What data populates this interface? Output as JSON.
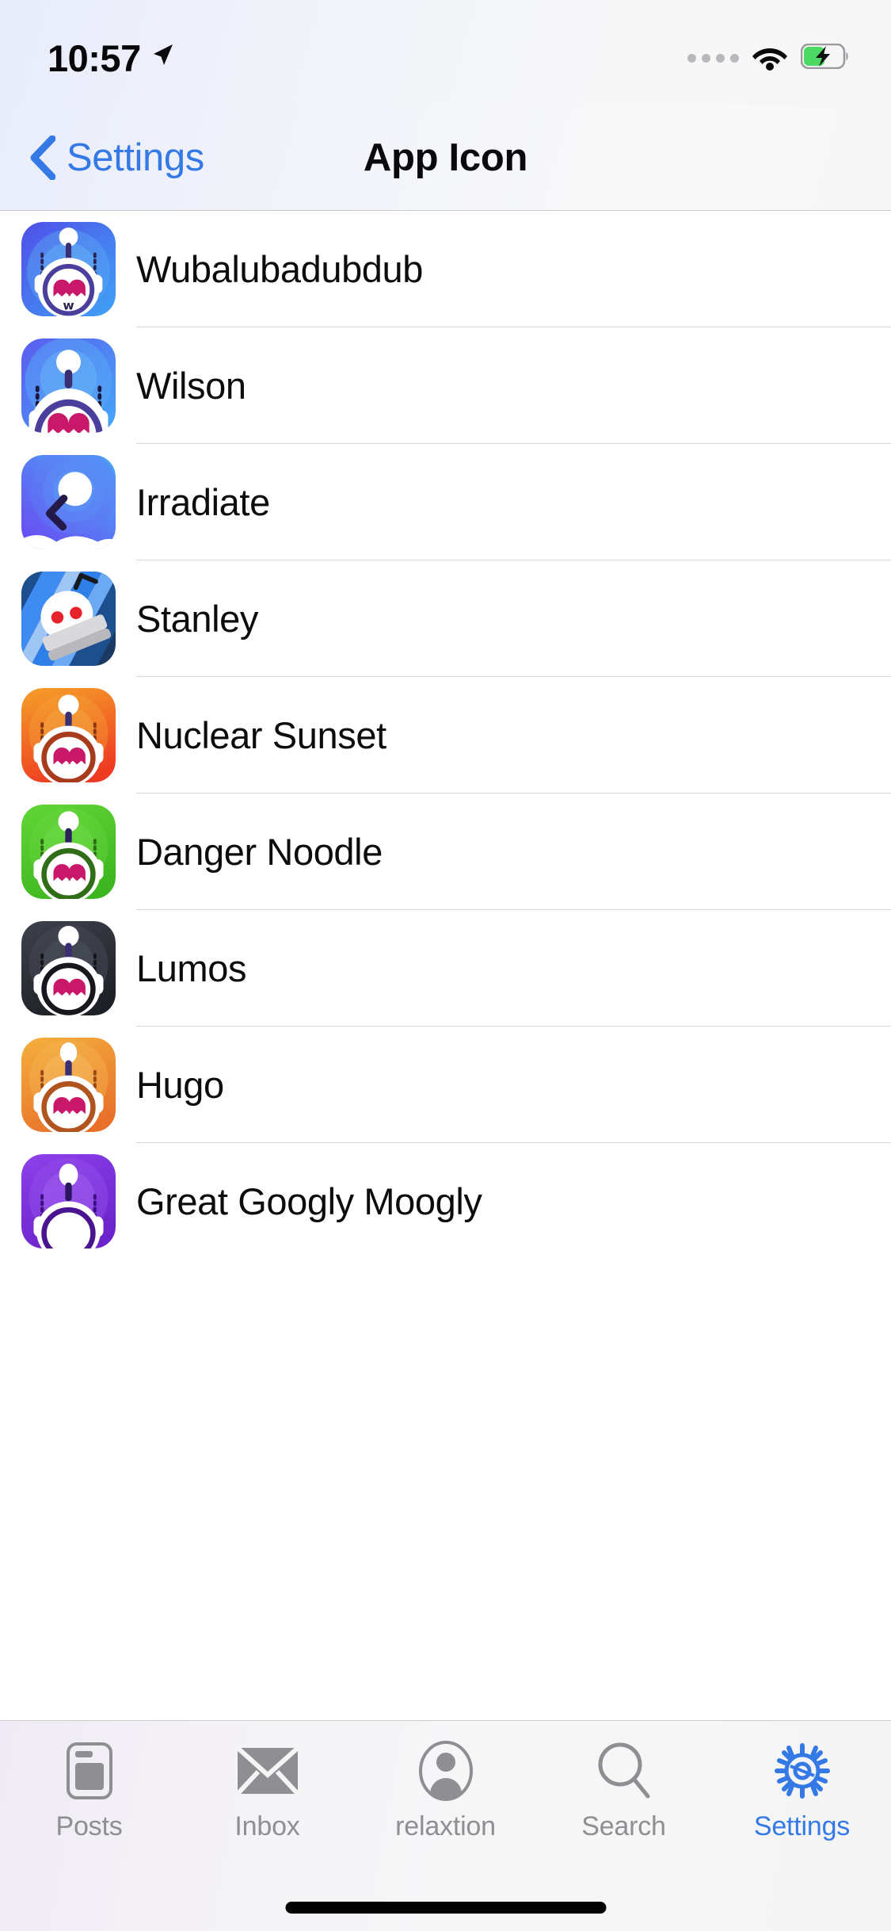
{
  "status_bar": {
    "time": "10:57",
    "location_icon": "location-arrow-icon",
    "signal_icon": "signal-dots-icon",
    "wifi_icon": "wifi-icon",
    "battery_icon": "battery-charging-icon",
    "battery_color": "#4cd964"
  },
  "nav": {
    "back_label": "Settings",
    "back_icon": "chevron-left-icon",
    "title": "App Icon",
    "accent_color": "#3579e6"
  },
  "list": {
    "items": [
      {
        "label": "Wubalubadubdub",
        "icon": "app-icon-wubalubadubdub",
        "style": "snoo-full",
        "c1": "#4f4ee8",
        "c2": "#3fa3f6",
        "ring": "#4b3f9e",
        "eyes": "#c9186a",
        "mouth": "w"
      },
      {
        "label": "Wilson",
        "icon": "app-icon-wilson",
        "style": "snoo-zoom",
        "c1": "#5b5cf0",
        "c2": "#44a8f8",
        "ring": "#4b3f9e",
        "eyes": "#c9186a",
        "mouth": ""
      },
      {
        "label": "Irradiate",
        "icon": "app-icon-irradiate",
        "style": "snoo-abstract",
        "c1": "#6a4bf2",
        "c2": "#4aa6f7",
        "ring": "#2b1f52",
        "eyes": "",
        "mouth": ""
      },
      {
        "label": "Stanley",
        "icon": "app-icon-stanley",
        "style": "snoo-stripes",
        "c1": "#1b3a63",
        "c2": "#2f7fe8",
        "ring": "#d2d2d4",
        "eyes": "#e8222a",
        "mouth": ""
      },
      {
        "label": "Nuclear Sunset",
        "icon": "app-icon-nuclear-sunset",
        "style": "snoo-full",
        "c1": "#f59a28",
        "c2": "#ee3a21",
        "ring": "#a83b1b",
        "eyes": "#c9186a",
        "mouth": ""
      },
      {
        "label": "Danger Noodle",
        "icon": "app-icon-danger-noodle",
        "style": "snoo-full",
        "c1": "#5fd435",
        "c2": "#3cb51f",
        "ring": "#2f6d16",
        "eyes": "#c9186a",
        "mouth": ""
      },
      {
        "label": "Lumos",
        "icon": "app-icon-lumos",
        "style": "snoo-full",
        "c1": "#3b3f48",
        "c2": "#1d2026",
        "ring": "#16181d",
        "eyes": "#c9186a",
        "mouth": ""
      },
      {
        "label": "Hugo",
        "icon": "app-icon-hugo",
        "style": "snoo-full",
        "c1": "#f4ab3c",
        "c2": "#e8702a",
        "ring": "#b1531d",
        "eyes": "#c9186a",
        "mouth": ""
      },
      {
        "label": "Great Googly Moogly",
        "icon": "app-icon-great-googly-moogly",
        "style": "snoo-full",
        "c1": "#8a3fe8",
        "c2": "#6a22c9",
        "ring": "#4a1490",
        "eyes": "#c9186a",
        "mouth": ""
      }
    ]
  },
  "tabbar": {
    "tabs": [
      {
        "label": "Posts",
        "icon": "posts-icon",
        "active": false
      },
      {
        "label": "Inbox",
        "icon": "inbox-envelope-icon",
        "active": false
      },
      {
        "label": "relaxtion",
        "icon": "profile-avatar-icon",
        "active": false
      },
      {
        "label": "Search",
        "icon": "search-magnifier-icon",
        "active": false
      },
      {
        "label": "Settings",
        "icon": "gear-icon",
        "active": true
      }
    ],
    "inactive_color": "#8e8e93",
    "active_color": "#3579e6"
  },
  "home_indicator": {
    "name": "home-indicator"
  }
}
